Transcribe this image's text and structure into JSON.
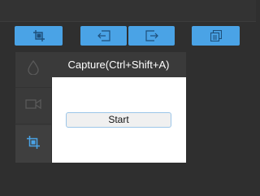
{
  "toolbar": {
    "buttons": [
      {
        "icon": "capture-icon"
      },
      {
        "icon": "import-icon"
      },
      {
        "icon": "export-icon"
      },
      {
        "icon": "copy-icon"
      }
    ]
  },
  "sidebar": {
    "items": [
      {
        "icon": "droplet-icon"
      },
      {
        "icon": "video-camera-icon"
      },
      {
        "icon": "capture-icon",
        "active": true
      }
    ]
  },
  "panel": {
    "title": "Capture(Ctrl+Shift+A)",
    "start_label": "Start"
  },
  "colors": {
    "accent": "#4aa3e6",
    "background": "#2f2f2f",
    "sidebar": "#3a3a3a",
    "icon_muted": "#5a5a5a"
  }
}
